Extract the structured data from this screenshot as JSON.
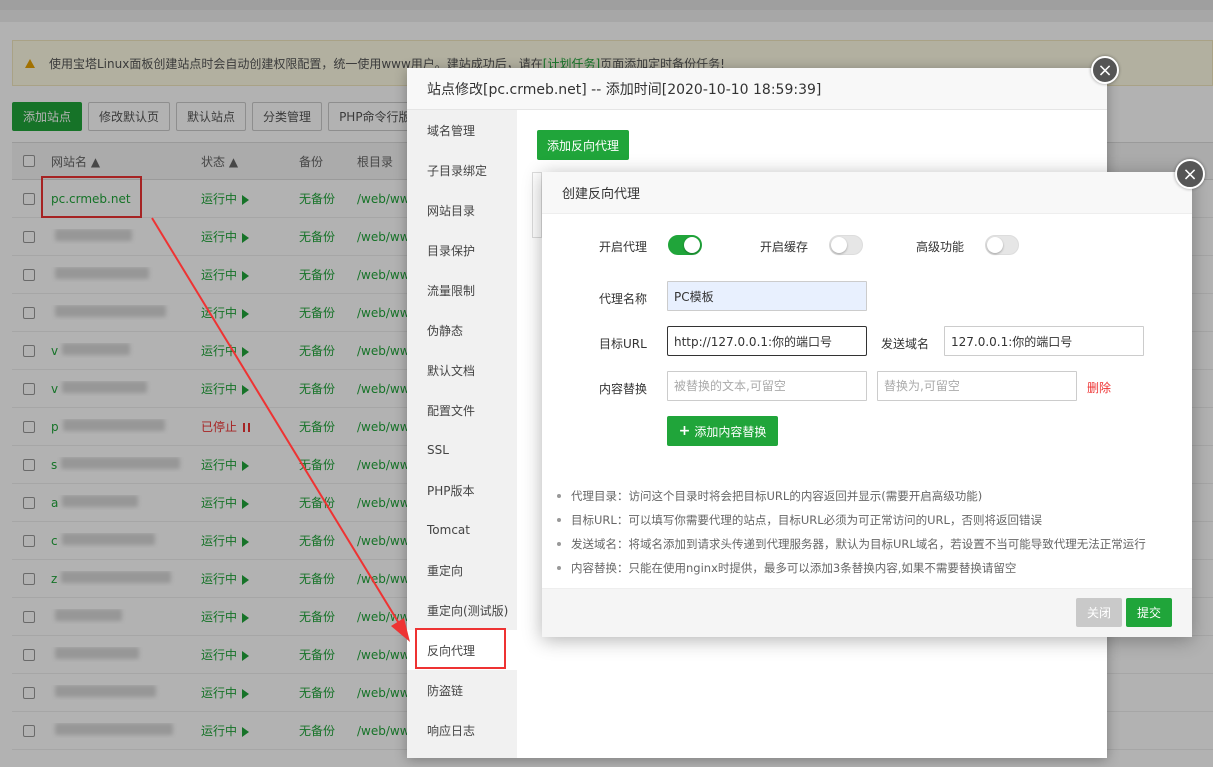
{
  "notice": {
    "text_before": "使用宝塔Linux面板创建站点时会自动创建权限配置，统一使用www用户。建站成功后，请在",
    "link": "[计划任务]",
    "text_after": "页面添加定时备份任务!"
  },
  "toolbar": [
    "添加站点",
    "修改默认页",
    "默认站点",
    "分类管理",
    "PHP命令行版本"
  ],
  "table": {
    "headers": {
      "name": "网站名 ▲",
      "status": "状态 ▲",
      "backup": "备份",
      "root": "根目录"
    },
    "rows": [
      {
        "name": "pc.crmeb.net",
        "status": "运行中",
        "backup": "无备份",
        "root": "/web/ww"
      },
      {
        "name": "",
        "status": "运行中",
        "backup": "无备份",
        "root": "/web/ww"
      },
      {
        "name": "",
        "status": "运行中",
        "backup": "无备份",
        "root": "/web/ww"
      },
      {
        "name": "",
        "status": "运行中",
        "backup": "无备份",
        "root": "/web/ww"
      },
      {
        "name": "v",
        "status": "运行中",
        "backup": "无备份",
        "root": "/web/ww"
      },
      {
        "name": "v",
        "status": "运行中",
        "backup": "无备份",
        "root": "/web/ww"
      },
      {
        "name": "p",
        "status": "已停止",
        "backup": "无备份",
        "root": "/web/ww"
      },
      {
        "name": "s",
        "status": "运行中",
        "backup": "无备份",
        "root": "/web/ww"
      },
      {
        "name": "a",
        "status": "运行中",
        "backup": "无备份",
        "root": "/web/ww"
      },
      {
        "name": "c",
        "status": "运行中",
        "backup": "无备份",
        "root": "/web/ww"
      },
      {
        "name": "z",
        "status": "运行中",
        "backup": "无备份",
        "root": "/web/ww"
      },
      {
        "name": "",
        "status": "运行中",
        "backup": "无备份",
        "root": "/web/ww"
      },
      {
        "name": "",
        "status": "运行中",
        "backup": "无备份",
        "root": "/web/ww"
      },
      {
        "name": "",
        "status": "运行中",
        "backup": "无备份",
        "root": "/web/ww"
      },
      {
        "name": "",
        "status": "运行中",
        "backup": "无备份",
        "root": "/web/ww"
      }
    ]
  },
  "site_modal": {
    "title": "站点修改[pc.crmeb.net] -- 添加时间[2020-10-10 18:59:39]",
    "close": "×",
    "menu": [
      "域名管理",
      "子目录绑定",
      "网站目录",
      "目录保护",
      "流量限制",
      "伪静态",
      "默认文档",
      "配置文件",
      "SSL",
      "PHP版本",
      "Tomcat",
      "重定向",
      "重定向(测试版)",
      "反向代理",
      "防盗链",
      "响应日志"
    ],
    "active_menu": "反向代理",
    "add_proxy": "添加反向代理"
  },
  "proxy_modal": {
    "title": "创建反向代理",
    "close": "×",
    "enable_proxy": {
      "label": "开启代理",
      "on": true
    },
    "enable_cache": {
      "label": "开启缓存",
      "on": false
    },
    "advanced": {
      "label": "高级功能",
      "on": false
    },
    "name_label": "代理名称",
    "name_value": "PC模板",
    "url_label": "目标URL",
    "url_value": "http://127.0.0.1:你的端口号",
    "domain_label": "发送域名",
    "domain_value": "127.0.0.1:你的端口号",
    "replace_label": "内容替换",
    "replace_from_placeholder": "被替换的文本,可留空",
    "replace_to_placeholder": "替换为,可留空",
    "delete": "删除",
    "add_replace": "添加内容替换",
    "tips": [
      "代理目录：访问这个目录时将会把目标URL的内容返回并显示(需要开启高级功能)",
      "目标URL：可以填写你需要代理的站点，目标URL必须为可正常访问的URL，否则将返回错误",
      "发送域名：将域名添加到请求头传递到代理服务器，默认为目标URL域名，若设置不当可能导致代理无法正常运行",
      "内容替换：只能在使用nginx时提供，最多可以添加3条替换内容,如果不需要替换请留空"
    ],
    "btn_close": "关闭",
    "btn_submit": "提交"
  },
  "colors": {
    "accent": "#20a53a",
    "danger": "#e33333",
    "annotation": "#ee3333"
  }
}
